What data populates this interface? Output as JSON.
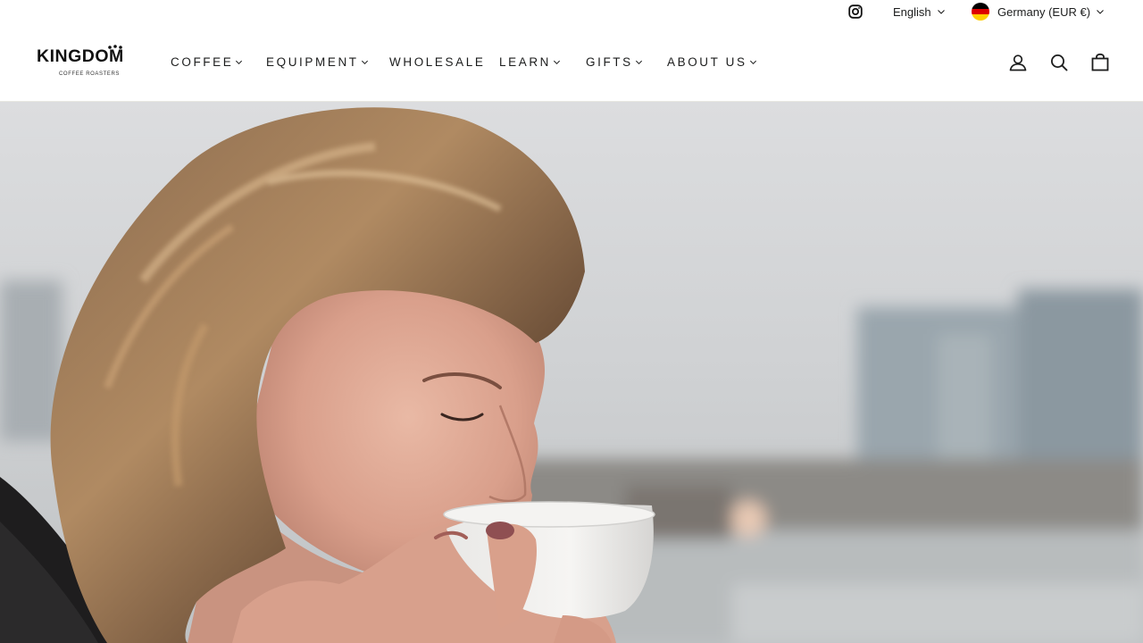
{
  "utility_bar": {
    "instagram_icon": "instagram-icon",
    "language": "English",
    "country": "Germany (EUR €)",
    "flag_colors": [
      "#000000",
      "#dd0000",
      "#ffce00"
    ]
  },
  "header": {
    "logo": {
      "name": "KINGDOM",
      "tagline": "COFFEE ROASTERS"
    },
    "nav": [
      {
        "label": "COFFEE",
        "has_dropdown": true
      },
      {
        "label": "EQUIPMENT",
        "has_dropdown": true
      },
      {
        "label": "WHOLESALE",
        "has_dropdown": false
      },
      {
        "label": "LEARN",
        "has_dropdown": true
      },
      {
        "label": "GIFTS",
        "has_dropdown": true
      },
      {
        "label": "ABOUT US",
        "has_dropdown": true
      }
    ],
    "icons": [
      "account-icon",
      "search-icon",
      "cart-icon"
    ]
  },
  "hero": {
    "image": "woman-sipping-coffee-photo"
  },
  "colors": {
    "text": "#1c1d1d",
    "border": "#e8e8e1",
    "background": "#ffffff"
  }
}
